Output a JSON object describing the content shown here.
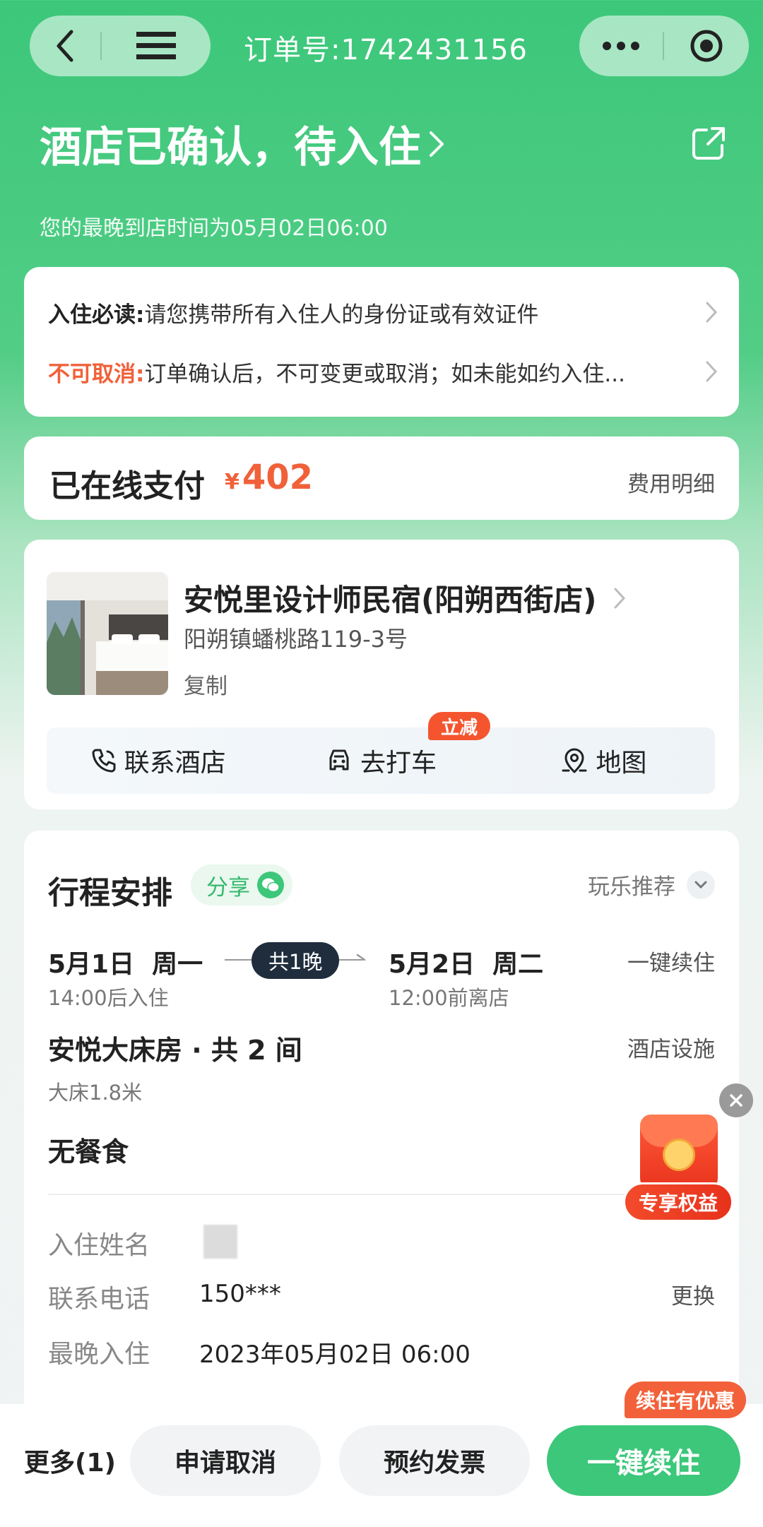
{
  "header": {
    "order_number_label": "订单号:1742431156"
  },
  "status": {
    "title": "酒店已确认，待入住",
    "arrival_note": "您的最晚到店时间为05月02日06:00"
  },
  "notices": [
    {
      "key": "入住必读:",
      "value": "请您携带所有入住人的身份证或有效证件"
    },
    {
      "key": "不可取消:",
      "value": "订单确认后，不可变更或取消；如未能如约入住..."
    }
  ],
  "payment": {
    "label": "已在线支付",
    "currency": "¥",
    "amount": "402",
    "detail_link": "费用明细"
  },
  "hotel": {
    "name": "安悦里设计师民宿(阳朔西街店)",
    "address": "阳朔镇蟠桃路119-3号",
    "copy_label": "复制",
    "actions": {
      "contact": "联系酒店",
      "taxi": "去打车",
      "taxi_promo": "立减",
      "map": "地图"
    }
  },
  "trip": {
    "title": "行程安排",
    "share_label": "分享",
    "recommend_label": "玩乐推荐",
    "checkin_date": "5月1日  周一",
    "checkin_time": "14:00后入住",
    "nights": "共1晚",
    "checkout_date": "5月2日  周二",
    "checkout_time": "12:00前离店",
    "renew_link": "一键续住",
    "room_name": "安悦大床房 · 共 2 间",
    "facilities_link": "酒店设施",
    "bed": "大床1.8米",
    "meal": "无餐食",
    "info": {
      "guest_name_label": "入住姓名",
      "phone_label": "联系电话",
      "phone_value": "150***",
      "change_link": "更换",
      "latest_checkin_label": "最晚入住",
      "latest_checkin_value": "2023年05月02日 06:00"
    }
  },
  "float_badge": {
    "label": "专享权益"
  },
  "bottom_bar": {
    "more": "更多(1)",
    "cancel": "申请取消",
    "invoice": "预约发票",
    "renew": "一键续住",
    "renew_tag": "续住有优惠"
  },
  "colors": {
    "brand_green": "#3cc77a",
    "price_orange": "#f0613a",
    "promo_red": "#f4552f"
  }
}
